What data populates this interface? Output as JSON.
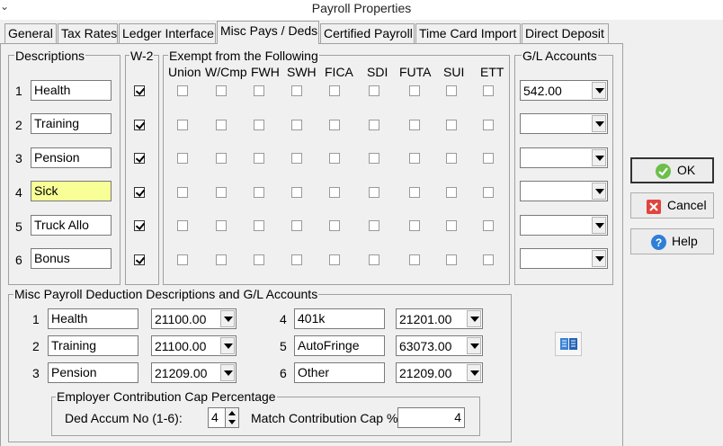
{
  "window": {
    "title": "Payroll Properties"
  },
  "tabs": [
    {
      "label": "General"
    },
    {
      "label": "Tax Rates"
    },
    {
      "label": "Ledger Interface"
    },
    {
      "label": "Misc Pays / Deds"
    },
    {
      "label": "Certified Payroll"
    },
    {
      "label": "Time Card Import"
    },
    {
      "label": "Direct Deposit"
    }
  ],
  "descriptions": {
    "title": "Descriptions",
    "rows": [
      {
        "num": "1",
        "text": "Health"
      },
      {
        "num": "2",
        "text": "Training"
      },
      {
        "num": "3",
        "text": "Pension"
      },
      {
        "num": "4",
        "text": "Sick"
      },
      {
        "num": "5",
        "text": "Truck Allo"
      },
      {
        "num": "6",
        "text": "Bonus"
      }
    ]
  },
  "w2": {
    "title": "W-2",
    "checked": [
      true,
      true,
      true,
      true,
      true,
      true
    ]
  },
  "exempt": {
    "title": "Exempt from the Following",
    "columns": [
      "Union",
      "W/Cmp",
      "FWH",
      "SWH",
      "FICA",
      "SDI",
      "FUTA",
      "SUI",
      "ETT"
    ]
  },
  "gl_accounts": {
    "title": "G/L Accounts",
    "values": [
      "542.00",
      "",
      "",
      "",
      "",
      ""
    ]
  },
  "buttons": {
    "ok": "OK",
    "cancel": "Cancel",
    "help": "Help"
  },
  "misc": {
    "title": "Misc Payroll Deduction Descriptions and G/L Accounts",
    "rows": [
      {
        "num": "1",
        "desc": "Health",
        "gl": "21100.00"
      },
      {
        "num": "2",
        "desc": "Training",
        "gl": "21100.00"
      },
      {
        "num": "3",
        "desc": "Pension",
        "gl": "21209.00"
      },
      {
        "num": "4",
        "desc": "401k",
        "gl": "21201.00"
      },
      {
        "num": "5",
        "desc": "AutoFringe",
        "gl": "63073.00"
      },
      {
        "num": "6",
        "desc": "Other",
        "gl": "21209.00"
      }
    ]
  },
  "cap": {
    "title": "Employer Contribution Cap Percentage",
    "ded_label": "Ded Accum No (1-6):",
    "ded_value": "4",
    "match_label": "Match Contribution Cap %",
    "match_value": "4"
  }
}
